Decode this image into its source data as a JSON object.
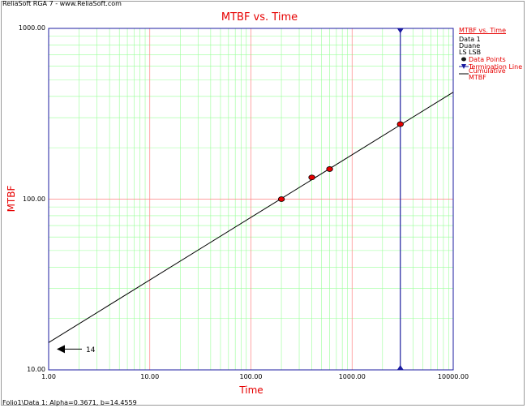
{
  "header": {
    "title": "ReliaSoft RGA 7 - www.ReliaSoft.com"
  },
  "footer": {
    "status": "Folio1\\Data 1: Alpha=0.3671, b=14.4559"
  },
  "legend": {
    "title": "MTBF vs. Time",
    "info": [
      "Data 1",
      "Duane",
      "LS LSB"
    ],
    "entries": [
      {
        "label": "Data Points",
        "color": "#e60000",
        "symbol": "dot-icon"
      },
      {
        "label": "Termination Line",
        "color": "#1c1ca0",
        "symbol": "triangle-down-icon"
      },
      {
        "label": "Cumulative MTBF",
        "color": "#000000",
        "symbol": "line-icon"
      }
    ]
  },
  "annotation": {
    "text": "14"
  },
  "chart_data": {
    "type": "line",
    "title": "MTBF vs. Time",
    "xlabel": "Time",
    "ylabel": "MTBF",
    "x_scale": "log",
    "y_scale": "log",
    "xlim": [
      1,
      10000
    ],
    "ylim": [
      10,
      1000
    ],
    "x_ticks": [
      "1.00",
      "10.00",
      "100.00",
      "1000.00",
      "10000.00"
    ],
    "y_ticks": [
      "10.00",
      "100.00",
      "1000.00"
    ],
    "grid": true,
    "legend_position": "right",
    "data_points": {
      "x": [
        200,
        400,
        600,
        3000
      ],
      "y": [
        100,
        134,
        150,
        275
      ]
    },
    "cumulative_mtbf": {
      "alpha": 0.3671,
      "b": 14.4559,
      "x": [
        1,
        10000
      ],
      "y": [
        14.45,
        423
      ]
    },
    "termination_line": {
      "x": 3000
    },
    "colors": {
      "axis_label": "#e60000",
      "major_grid": "#ff8080",
      "minor_grid": "#99ff99",
      "points": "#e60000",
      "termination": "#1c1ca0",
      "fit": "#000000"
    }
  }
}
